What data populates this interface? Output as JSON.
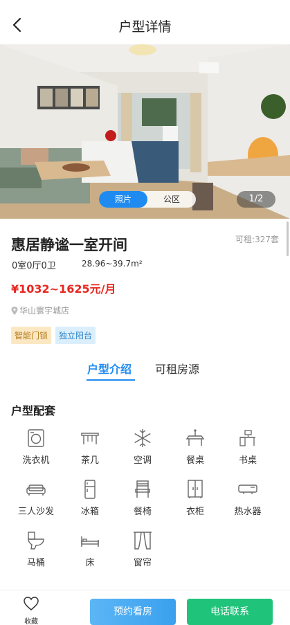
{
  "header": {
    "title": "户型详情"
  },
  "gallery": {
    "tabs": [
      {
        "label": "照片"
      },
      {
        "label": "公区"
      }
    ],
    "counter": "1/2"
  },
  "room": {
    "title": "惠居静谧一室开间",
    "available": "可租:327套",
    "layout": "0室0厅0卫",
    "area": "28.96~39.7m²",
    "price": "¥1032~1625元/月",
    "store": "华山寰宇城店",
    "tags": [
      "智能门锁",
      "独立阳台"
    ]
  },
  "section_tabs": [
    {
      "label": "户型介绍"
    },
    {
      "label": "可租房源"
    }
  ],
  "facilities": {
    "title": "户型配套",
    "items": [
      {
        "label": "洗衣机",
        "icon": "washing-machine-icon"
      },
      {
        "label": "茶几",
        "icon": "coffee-table-icon"
      },
      {
        "label": "空调",
        "icon": "air-conditioner-icon"
      },
      {
        "label": "餐桌",
        "icon": "dining-table-icon"
      },
      {
        "label": "书桌",
        "icon": "desk-icon"
      },
      {
        "label": "三人沙发",
        "icon": "sofa-icon"
      },
      {
        "label": "冰箱",
        "icon": "fridge-icon"
      },
      {
        "label": "餐椅",
        "icon": "dining-chair-icon"
      },
      {
        "label": "衣柜",
        "icon": "wardrobe-icon"
      },
      {
        "label": "热水器",
        "icon": "water-heater-icon"
      },
      {
        "label": "马桶",
        "icon": "toilet-icon"
      },
      {
        "label": "床",
        "icon": "bed-icon"
      },
      {
        "label": "窗帘",
        "icon": "curtain-icon"
      }
    ]
  },
  "bottom": {
    "favorite": "收藏",
    "book": "预约看房",
    "call": "电话联系"
  },
  "colors": {
    "accent": "#1f8bf0",
    "price": "#e8261e",
    "call": "#1fc37a"
  }
}
